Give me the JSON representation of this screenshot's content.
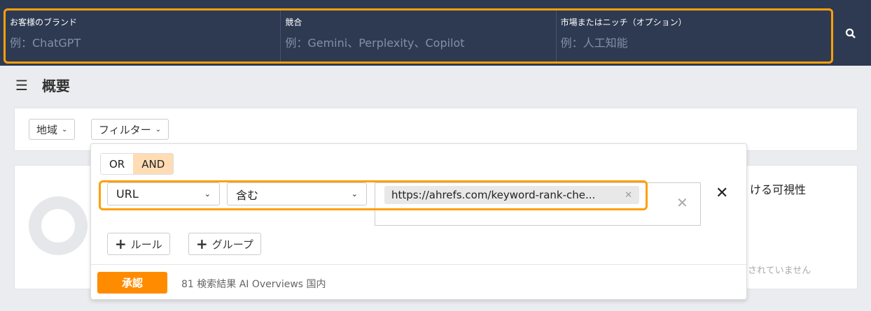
{
  "topbar": {
    "fields": [
      {
        "label": "お客様のブランド",
        "placeholder": "例：ChatGPT"
      },
      {
        "label": "競合",
        "placeholder": "例：Gemini、Perplexity、Copilot"
      },
      {
        "label": "市場またはニッチ（オプション）",
        "placeholder": "例：人工知能"
      }
    ]
  },
  "page": {
    "title": "概要"
  },
  "filters": {
    "region_label": "地域",
    "filter_label": "フィルター"
  },
  "background_card": {
    "heading_fragment": "ける可視性",
    "status_fragment": "されていません"
  },
  "filter_popover": {
    "logic": {
      "or": "OR",
      "and": "AND",
      "selected": "AND"
    },
    "rule": {
      "field": "URL",
      "operator": "含む",
      "value_tag": "https://ahrefs.com/keyword-rank-che..."
    },
    "add_rule": "ルール",
    "add_group": "グループ",
    "apply": "承認",
    "result_summary": "81 検索結果 AI Overviews 国内"
  },
  "colors": {
    "accent": "#ff8c00",
    "topbar": "#2e3a52",
    "highlight": "#ff9f0a"
  }
}
